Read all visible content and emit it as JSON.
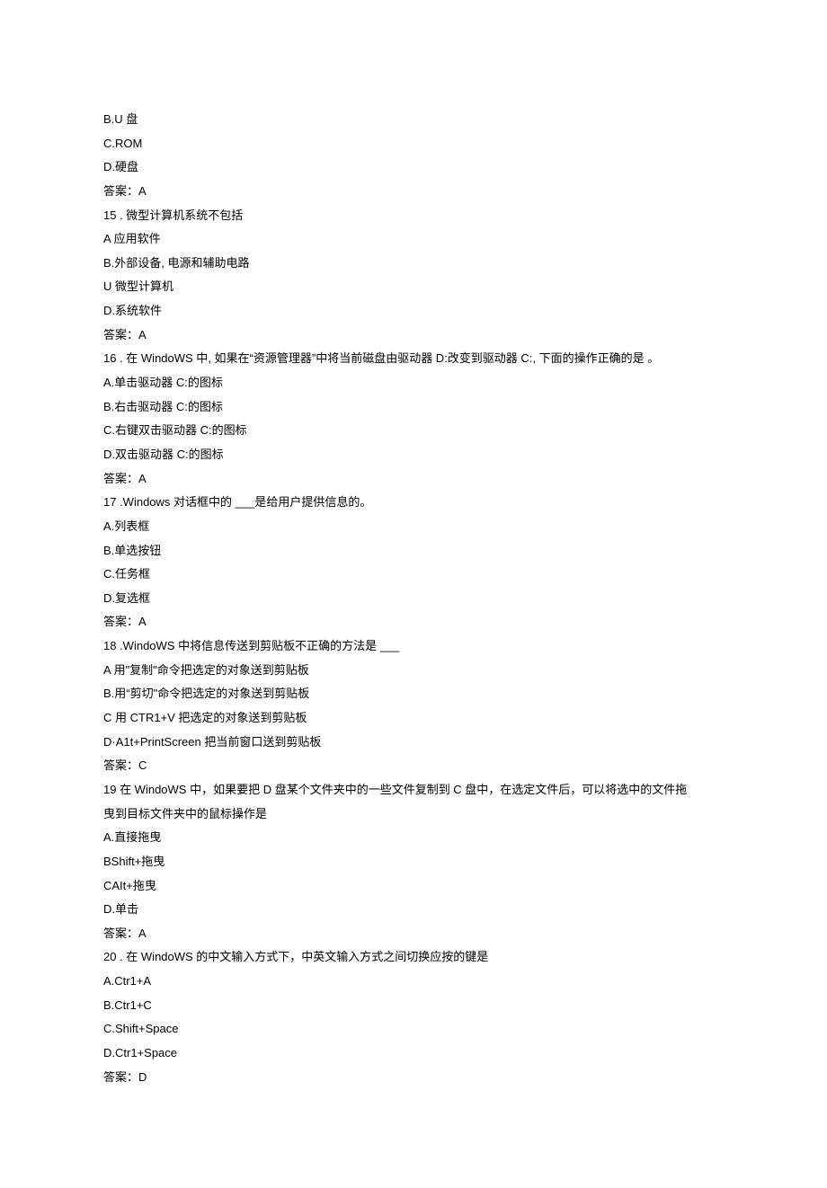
{
  "lines": [
    "B.U 盘",
    "C.ROM",
    "D.硬盘",
    "答案：A",
    "15    . 微型计算机系统不包括",
    "A 应用软件",
    "B.外部设备, 电源和辅助电路",
    "U 微型计算机",
    "D.系统软件",
    "答案：A",
    "16    . 在 WindoWS 中, 如果在“资源管理器”中将当前磁盘由驱动器 D:改变到驱动器 C:, 下面的操作正确的是 。",
    "A.单击驱动器 C:的图标",
    "B.右击驱动器 C:的图标",
    "C.右键双击驱动器 C:的图标",
    "D.双击驱动器 C:的图标",
    "答案：A",
    "17    .Windows 对话框中的 ___是给用户提供信息的。",
    "A.列表框",
    "B.单选按钮",
    "C.任务框",
    "D.复选框",
    "答案：A",
    "18    .WindoWS 中将信息传送到剪贴板不正确的方法是 ___",
    "A 用\"复制\"命令把选定的对象送到剪贴板",
    "B.用“剪切\"命令把选定的对象送到剪贴板",
    "C 用 CTR1+V 把选定的对象送到剪贴板",
    "D·A1t+PrintScreen 把当前窗口送到剪贴板",
    "答案：C",
    "19 在 WindoWS 中，如果要把 D 盘某个文件夹中的一些文件复制到 C 盘中，在选定文件后，可以将选中的文件拖",
    "曳到目标文件夹中的鼠标操作是",
    "A.直接拖曳",
    "BShift+拖曳",
    "CAIt+拖曳",
    "D.单击",
    "答案：A",
    "20    . 在 WindoWS 的中文输入方式下，中英文输入方式之间切换应按的键是",
    "A.Ctr1+A",
    "B.Ctr1+C",
    "C.Shift+Space",
    "D.Ctr1+Space",
    "答案：D"
  ]
}
